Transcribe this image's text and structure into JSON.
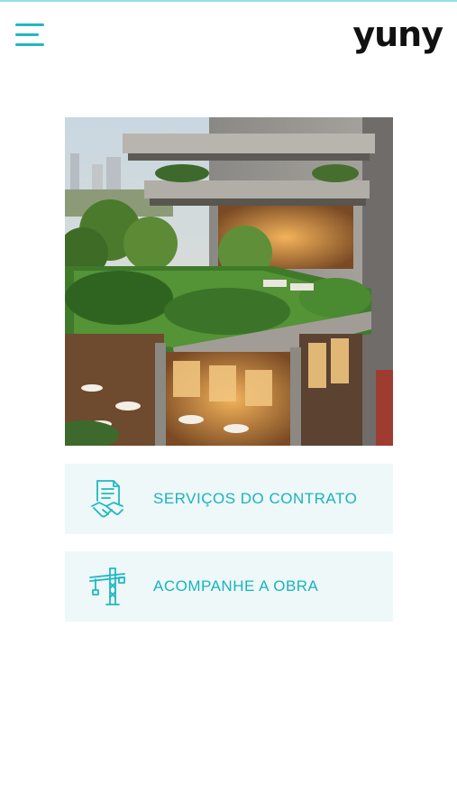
{
  "header": {
    "menu_icon": "hamburger-menu-icon",
    "logo_text": "yuny"
  },
  "hero": {
    "image": "building-rooftop-garden-rendering"
  },
  "actions": [
    {
      "label": "SERVIÇOS DO CONTRATO",
      "icon": "contract-handshake-icon"
    },
    {
      "label": "ACOMPANHE A OBRA",
      "icon": "construction-crane-icon"
    }
  ],
  "colors": {
    "accent": "#1fb8c4",
    "card_background": "#eef8f8",
    "logo": "#111111"
  }
}
